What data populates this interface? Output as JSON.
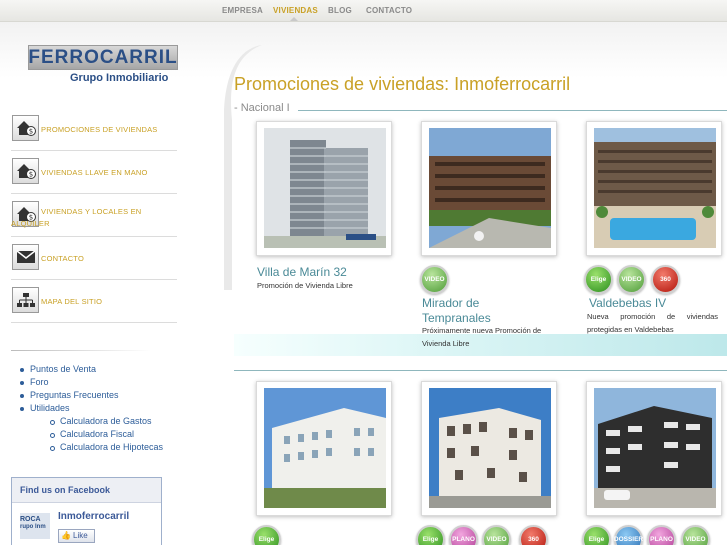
{
  "nav": {
    "items": [
      {
        "label": "EMPRESA"
      },
      {
        "label": "VIVIENDAS",
        "active": true
      },
      {
        "label": "BLOG"
      },
      {
        "label": "CONTACTO"
      }
    ]
  },
  "logo": {
    "name": "FERROCARRIL",
    "subtitle": "Grupo Inmobiliario"
  },
  "sidebar": {
    "items": [
      {
        "label": "PROMOCIONES DE VIVIENDAS",
        "icon": "house-euro-icon"
      },
      {
        "label": "VIVIENDAS LLAVE EN MANO",
        "icon": "house-euro-icon"
      },
      {
        "label": "VIVIENDAS Y LOCALES EN ALQUILER",
        "icon": "house-euro-icon"
      },
      {
        "label": "CONTACTO",
        "icon": "envelope-icon"
      },
      {
        "label": "MAPA DEL SITIO",
        "icon": "sitemap-icon"
      }
    ],
    "links": [
      "Puntos de Venta",
      "Foro",
      "Preguntas Frecuentes",
      "Utilidades"
    ],
    "utilidades": [
      "Calculadora de Gastos",
      "Calculadora Fiscal",
      "Calculadora de Hipotecas"
    ]
  },
  "facebook": {
    "heading": "Find us on Facebook",
    "page_name": "Inmoferrocarril",
    "logo_text": "ROCA",
    "logo_sub": "rupo Inm",
    "like_label": "Like"
  },
  "main": {
    "title": "Promociones de viviendas: Inmoferrocarril",
    "section": "- Nacional I",
    "promotions": [
      {
        "title": "Villa de Marín 32",
        "desc": "Promoción de Vivienda Libre",
        "badges": []
      },
      {
        "title": "Mirador de Tempranales",
        "desc": "Próximamente nueva Promoción de Vivienda Libre",
        "badges": [
          "VIDEO"
        ]
      },
      {
        "title": "Valdebebas IV",
        "desc": "Nueva promoción de viviendas protegidas en Valdebebas",
        "badges": [
          "Elige",
          "VIDEO",
          "360"
        ]
      }
    ],
    "row2_badges": [
      [
        "Elige"
      ],
      [
        "Elige",
        "PLANO",
        "VIDEO",
        "360"
      ],
      [
        "Elige",
        "DOSSIER",
        "PLANO",
        "VIDEO"
      ]
    ]
  },
  "colors": {
    "gold": "#c9a126",
    "blue": "#2b4f86",
    "teal": "#4a8a97"
  }
}
